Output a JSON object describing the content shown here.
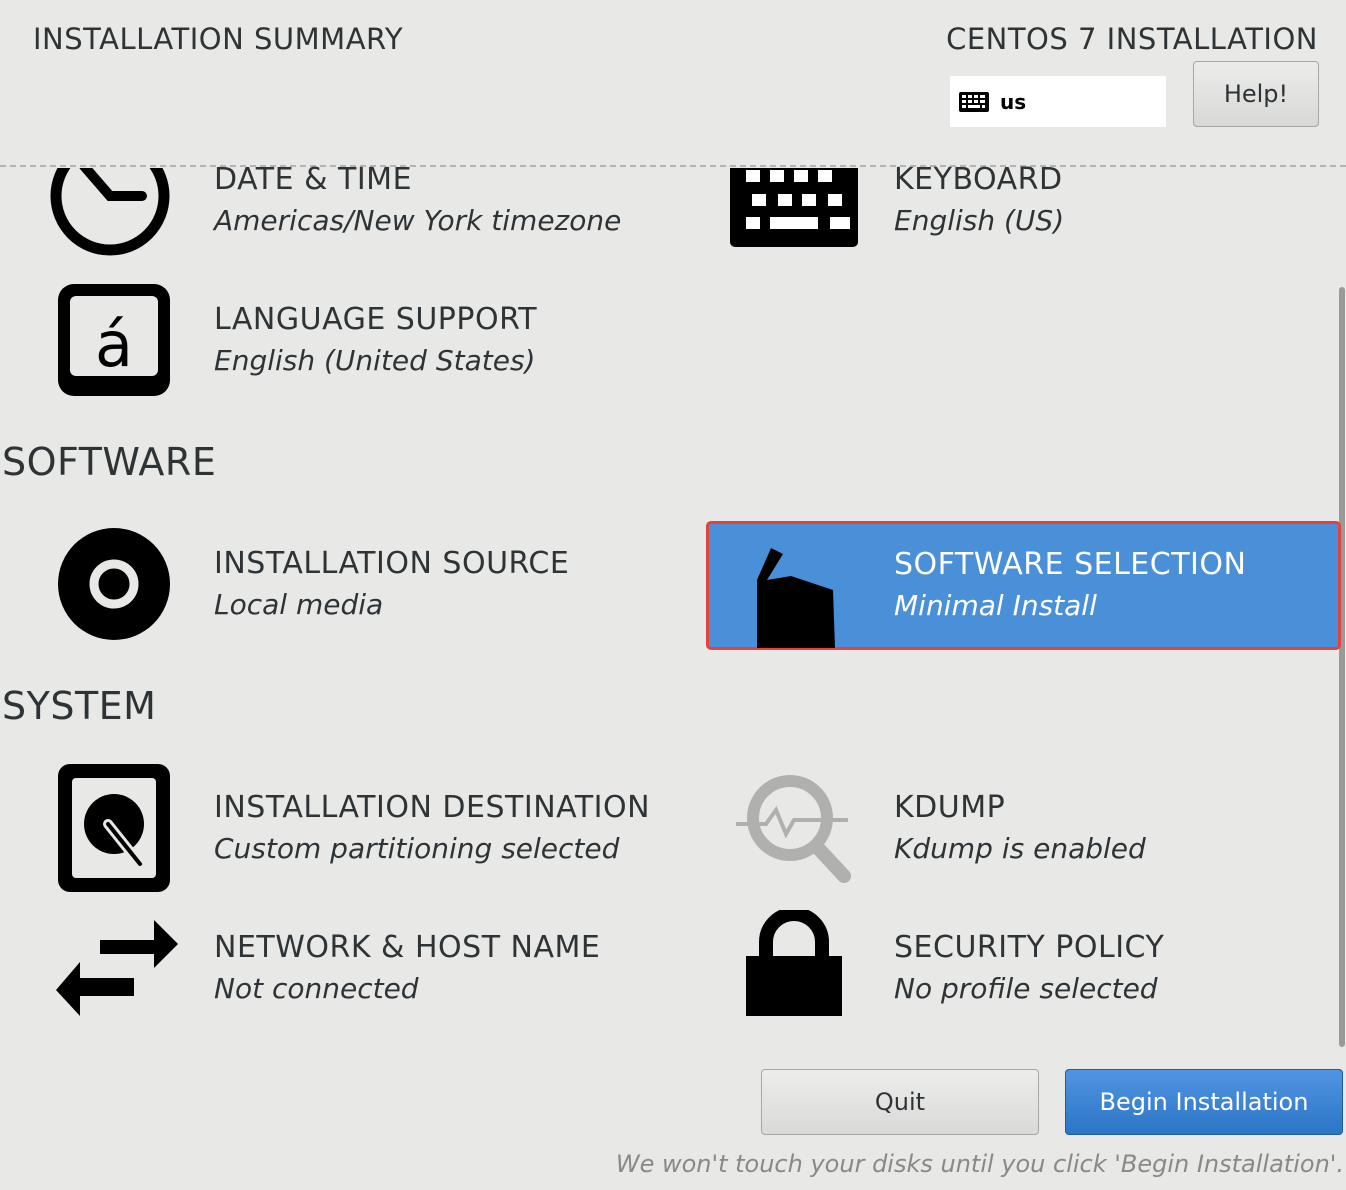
{
  "header": {
    "title": "INSTALLATION SUMMARY",
    "product": "CENTOS 7 INSTALLATION",
    "keyboard_layout": "us",
    "help_label": "Help!"
  },
  "localization": {
    "date_time": {
      "title": "DATE & TIME",
      "status": "Americas/New York timezone",
      "icon": "clock-icon"
    },
    "keyboard": {
      "title": "KEYBOARD",
      "status": "English (US)",
      "icon": "keyboard-icon"
    },
    "language": {
      "title": "LANGUAGE SUPPORT",
      "status": "English (United States)",
      "icon": "language-icon"
    }
  },
  "software": {
    "title": "SOFTWARE",
    "source": {
      "title": "INSTALLATION SOURCE",
      "status": "Local media",
      "icon": "disc-icon"
    },
    "selection": {
      "title": "SOFTWARE SELECTION",
      "status": "Minimal Install",
      "icon": "package-box-icon",
      "selected": true
    }
  },
  "system": {
    "title": "SYSTEM",
    "destination": {
      "title": "INSTALLATION DESTINATION",
      "status": "Custom partitioning selected",
      "icon": "hard-disk-icon"
    },
    "kdump": {
      "title": "KDUMP",
      "status": "Kdump is enabled",
      "icon": "kdump-search-icon"
    },
    "network": {
      "title": "NETWORK & HOST NAME",
      "status": "Not connected",
      "icon": "network-arrows-icon"
    },
    "security": {
      "title": "SECURITY POLICY",
      "status": "No profile selected",
      "icon": "lock-icon"
    }
  },
  "footer": {
    "quit_label": "Quit",
    "begin_label": "Begin Installation",
    "note": "We won't touch your disks until you click 'Begin Installation'."
  },
  "colors": {
    "background": "#e8e8e7",
    "selected_spoke": "#4a90d9",
    "selected_outline": "#e0443a",
    "begin_button": "#2a76c6"
  }
}
